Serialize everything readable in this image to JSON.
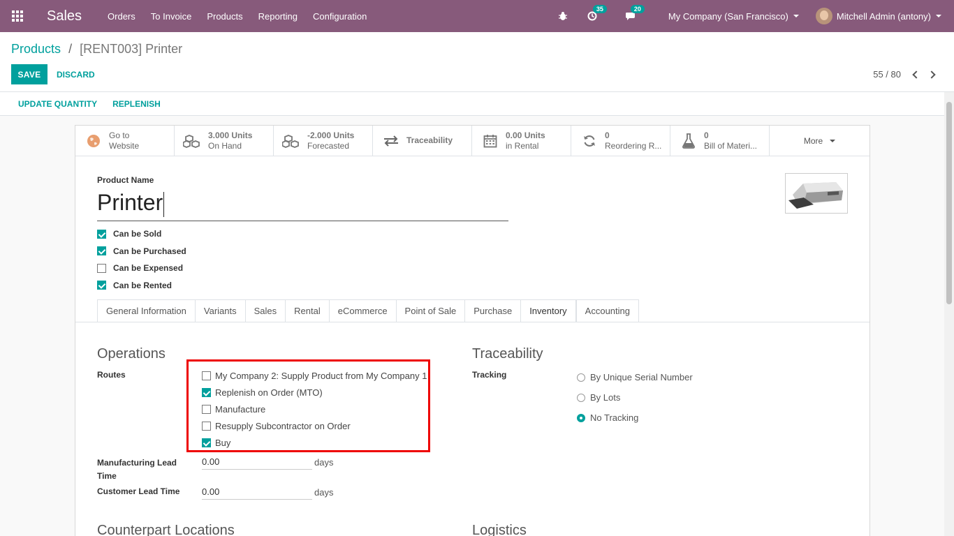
{
  "navbar": {
    "app_name": "Sales",
    "menu": [
      "Orders",
      "To Invoice",
      "Products",
      "Reporting",
      "Configuration"
    ],
    "activity_count": "35",
    "message_count": "20",
    "company": "My Company (San Francisco)",
    "user": "Mitchell Admin (antony)",
    "color": "#875a7b"
  },
  "breadcrumb": {
    "parent": "Products",
    "separator": "/",
    "current": "[RENT003] Printer"
  },
  "actions": {
    "save": "SAVE",
    "discard": "DISCARD"
  },
  "pager": {
    "value": "55 / 80"
  },
  "statusbar": {
    "update_quantity": "UPDATE QUANTITY",
    "replenish": "REPLENISH"
  },
  "smart_buttons": [
    {
      "line1": "Go to",
      "line2": "Website",
      "icon": "globe-icon"
    },
    {
      "line1": "3.000 Units",
      "line2": "On Hand",
      "icon": "cubes-icon"
    },
    {
      "line1": "-2.000 Units",
      "line2": "Forecasted",
      "icon": "cubes-icon"
    },
    {
      "line1": "Traceability",
      "icon": "exchange-icon"
    },
    {
      "line1": "0.00 Units",
      "line2": "in Rental",
      "icon": "calendar-icon"
    },
    {
      "line1": "0",
      "line2": "Reordering R...",
      "icon": "refresh-icon"
    },
    {
      "line1": "0",
      "line2": "Bill of Materi...",
      "icon": "flask-icon"
    }
  ],
  "more": "More",
  "product": {
    "name_label": "Product Name",
    "name": "Printer",
    "checkboxes": [
      {
        "label": "Can be Sold",
        "checked": true
      },
      {
        "label": "Can be Purchased",
        "checked": true
      },
      {
        "label": "Can be Expensed",
        "checked": false
      },
      {
        "label": "Can be Rented",
        "checked": true
      }
    ]
  },
  "tabs": [
    "General Information",
    "Variants",
    "Sales",
    "Rental",
    "eCommerce",
    "Point of Sale",
    "Purchase",
    "Inventory",
    "Accounting"
  ],
  "active_tab": "Inventory",
  "operations": {
    "title": "Operations",
    "routes_label": "Routes",
    "routes": [
      {
        "label": "My Company 2: Supply Product from My Company 1",
        "checked": false
      },
      {
        "label": "Replenish on Order (MTO)",
        "checked": true
      },
      {
        "label": "Manufacture",
        "checked": false
      },
      {
        "label": "Resupply Subcontractor on Order",
        "checked": false
      },
      {
        "label": "Buy",
        "checked": true
      }
    ],
    "mfg_lead_label": "Manufacturing Lead Time",
    "mfg_lead_value": "0.00",
    "cust_lead_label": "Customer Lead Time",
    "cust_lead_value": "0.00",
    "unit": "days"
  },
  "traceability": {
    "title": "Traceability",
    "tracking_label": "Tracking",
    "options": [
      {
        "label": "By Unique Serial Number",
        "selected": false
      },
      {
        "label": "By Lots",
        "selected": false
      },
      {
        "label": "No Tracking",
        "selected": true
      }
    ]
  },
  "lower_sections": {
    "counterpart": "Counterpart Locations",
    "logistics": "Logistics"
  },
  "accent_color": "#00a09d",
  "highlight_color": "#ee0000"
}
